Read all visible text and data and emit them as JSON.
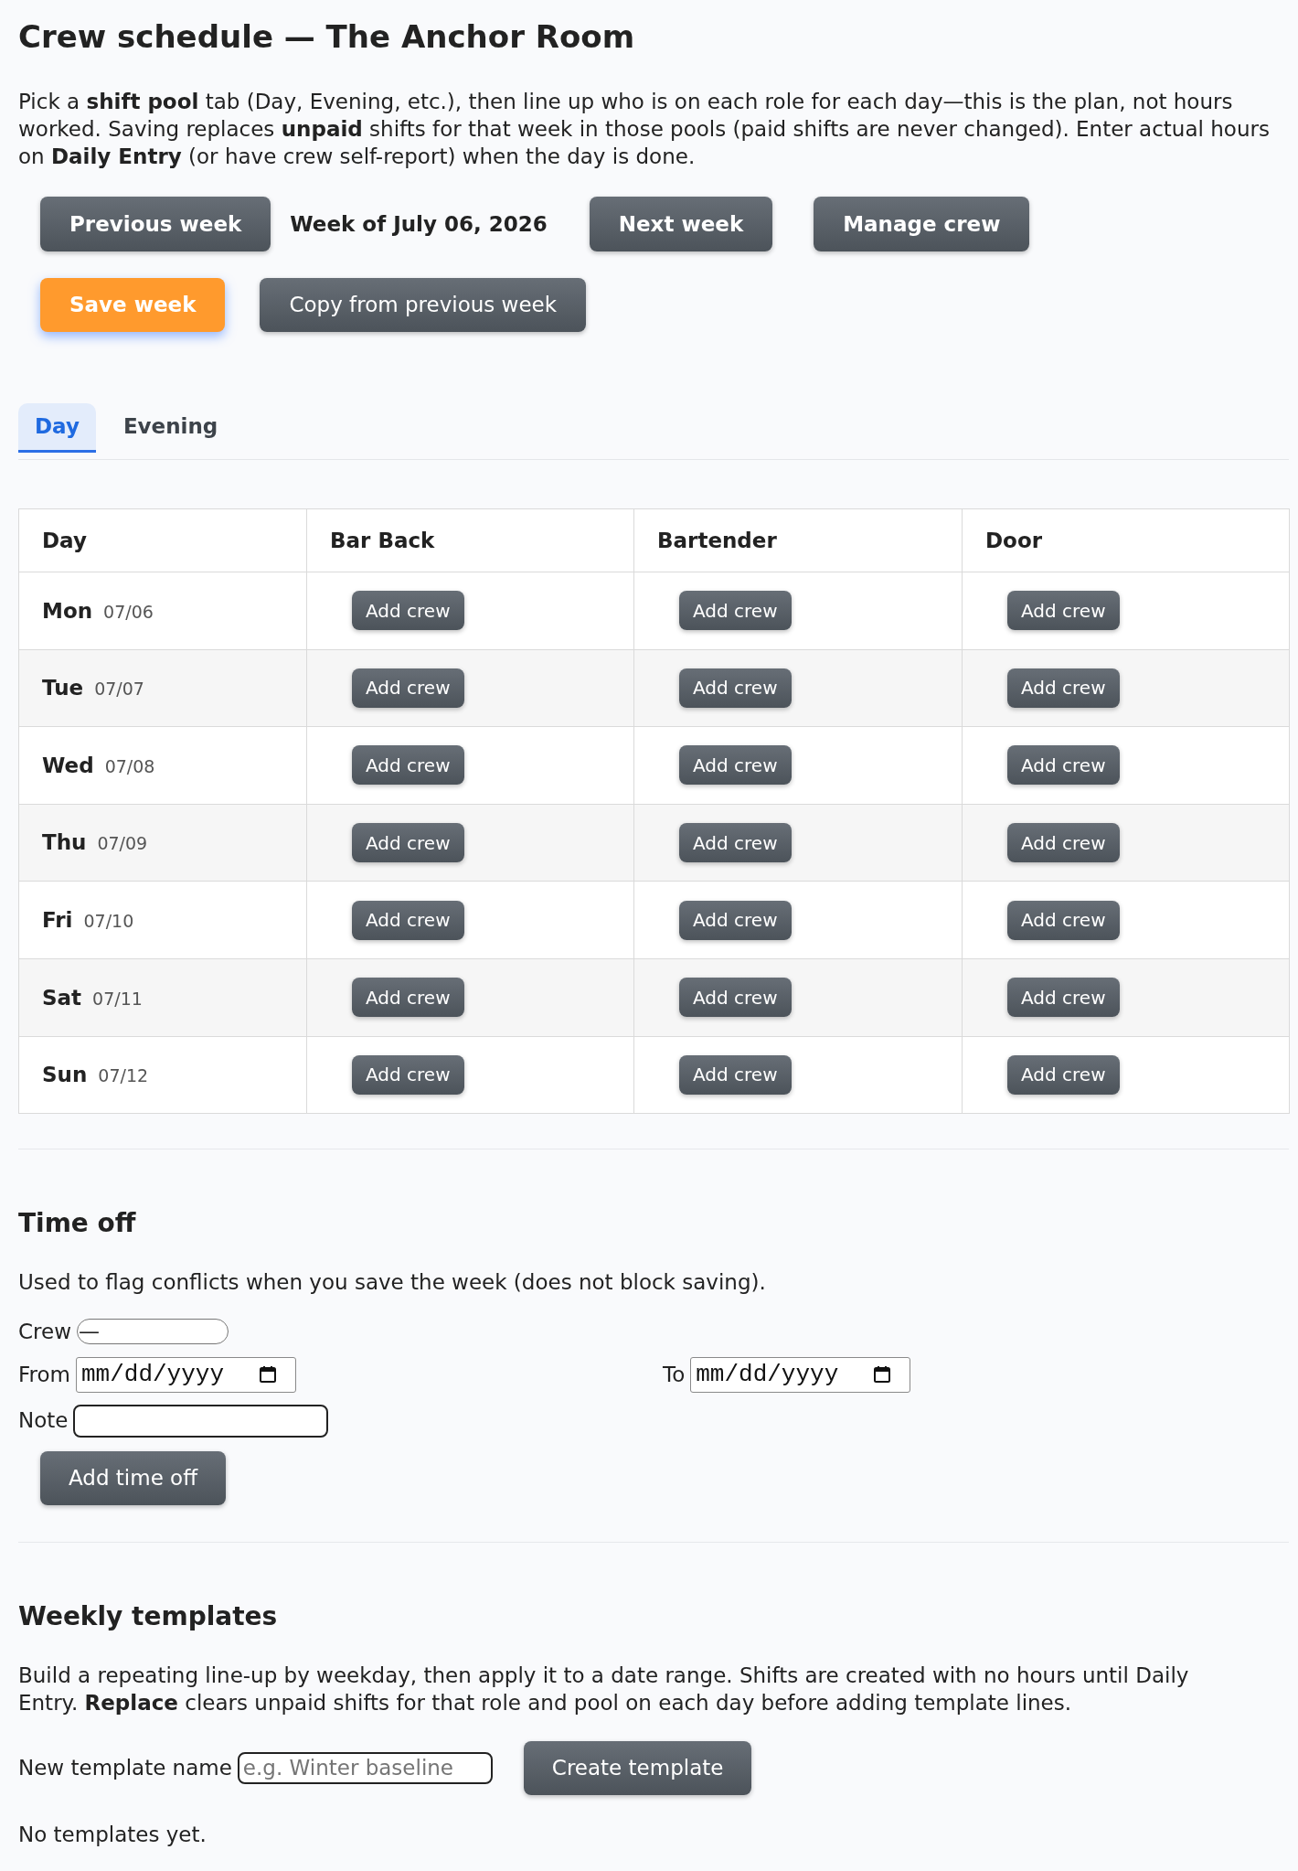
{
  "page": {
    "title": "Crew schedule — The Anchor Room",
    "intro": "Pick a **shift pool** tab (Day, Evening, etc.), then line up who is on each role for each day—this is the plan, not hours worked. Saving replaces **unpaid** shifts for that week in those pools (paid shifts are never changed). Enter actual hours on **Daily Entry** (or have crew self-report) when the day is done."
  },
  "week_nav": {
    "previous_button": "Previous week",
    "week_label": "Week of July 06, 2026",
    "next_button": "Next week",
    "manage_button": "Manage crew"
  },
  "actions": [
    {
      "label": "Save week",
      "kind": "primary",
      "focused": true
    },
    {
      "label": "Copy from previous week",
      "kind": "secondary",
      "focused": false
    }
  ],
  "tabs": [
    {
      "label": "Day",
      "selected": true
    },
    {
      "label": "Evening",
      "selected": false
    }
  ],
  "table": {
    "columns": [
      "Day",
      "Bar Back",
      "Bartender",
      "Door"
    ],
    "rows": [
      [
        {
          "day": "Mon",
          "date": "07/06"
        },
        "Add crew",
        "Add crew",
        "Add crew"
      ],
      [
        {
          "day": "Tue",
          "date": "07/07"
        },
        "Add crew",
        "Add crew",
        "Add crew"
      ],
      [
        {
          "day": "Wed",
          "date": "07/08"
        },
        "Add crew",
        "Add crew",
        "Add crew"
      ],
      [
        {
          "day": "Thu",
          "date": "07/09"
        },
        "Add crew",
        "Add crew",
        "Add crew"
      ],
      [
        {
          "day": "Fri",
          "date": "07/10"
        },
        "Add crew",
        "Add crew",
        "Add crew"
      ],
      [
        {
          "day": "Sat",
          "date": "07/11"
        },
        "Add crew",
        "Add crew",
        "Add crew"
      ],
      [
        {
          "day": "Sun",
          "date": "07/12"
        },
        "Add crew",
        "Add crew",
        "Add crew"
      ]
    ]
  },
  "time_off": {
    "heading": "Time off",
    "description": "Used to flag conflicts when you save the week (does not block saving).",
    "crew": {
      "label": "Crew",
      "value": "—"
    },
    "from": {
      "label": "From",
      "placeholder": "mm/dd/yyyy"
    },
    "to": {
      "label": "To",
      "placeholder": "mm/dd/yyyy"
    },
    "note": {
      "label": "Note"
    },
    "button": "Add time off"
  },
  "templates": {
    "heading": "Weekly templates",
    "description": "Build a repeating line-up by weekday, then apply it to a date range. Shifts are created with no hours until Daily Entry. **Replace** clears unpaid shifts for that role and pool on each day before adding template lines.",
    "name_field": {
      "label": "New template name",
      "placeholder": "e.g. Winter baseline"
    },
    "button": "Create template",
    "empty_message": "No templates yet."
  }
}
